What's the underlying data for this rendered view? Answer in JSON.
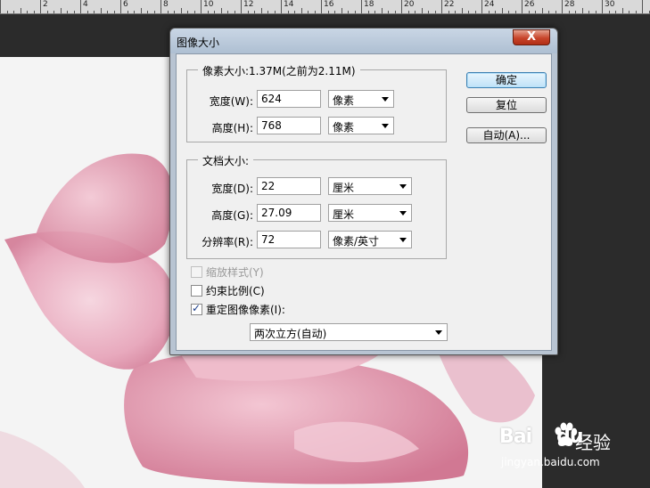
{
  "ruler": {
    "labels": [
      "2",
      "4",
      "6",
      "8",
      "10",
      "12",
      "14",
      "16",
      "18",
      "20",
      "22",
      "24",
      "26",
      "28",
      "30"
    ]
  },
  "dialog": {
    "title": "图像大小",
    "close_label": "X",
    "pixel_group": {
      "legend": "像素大小:1.37M(之前为2.11M)",
      "width_label": "宽度(W):",
      "width_value": "624",
      "width_unit": "像素",
      "height_label": "高度(H):",
      "height_value": "768",
      "height_unit": "像素"
    },
    "doc_group": {
      "legend": "文档大小:",
      "width_label": "宽度(D):",
      "width_value": "22",
      "width_unit": "厘米",
      "height_label": "高度(G):",
      "height_value": "27.09",
      "height_unit": "厘米",
      "res_label": "分辨率(R):",
      "res_value": "72",
      "res_unit": "像素/英寸"
    },
    "buttons": {
      "ok": "确定",
      "reset": "复位",
      "auto": "自动(A)..."
    },
    "checkboxes": {
      "scale_styles": "缩放样式(Y)",
      "constrain": "约束比例(C)",
      "resample": "重定图像像素(I):"
    },
    "resample_method": "两次立方(自动)"
  },
  "watermark": {
    "logo": "Bai",
    "logo_end": "du",
    "jingyan": "经验",
    "url": "jingyan.baidu.com"
  },
  "colors": {
    "accent_arrow": "#e8303a",
    "petal": "#e8a7bb",
    "dialog_frame": "#b8c4d2"
  }
}
